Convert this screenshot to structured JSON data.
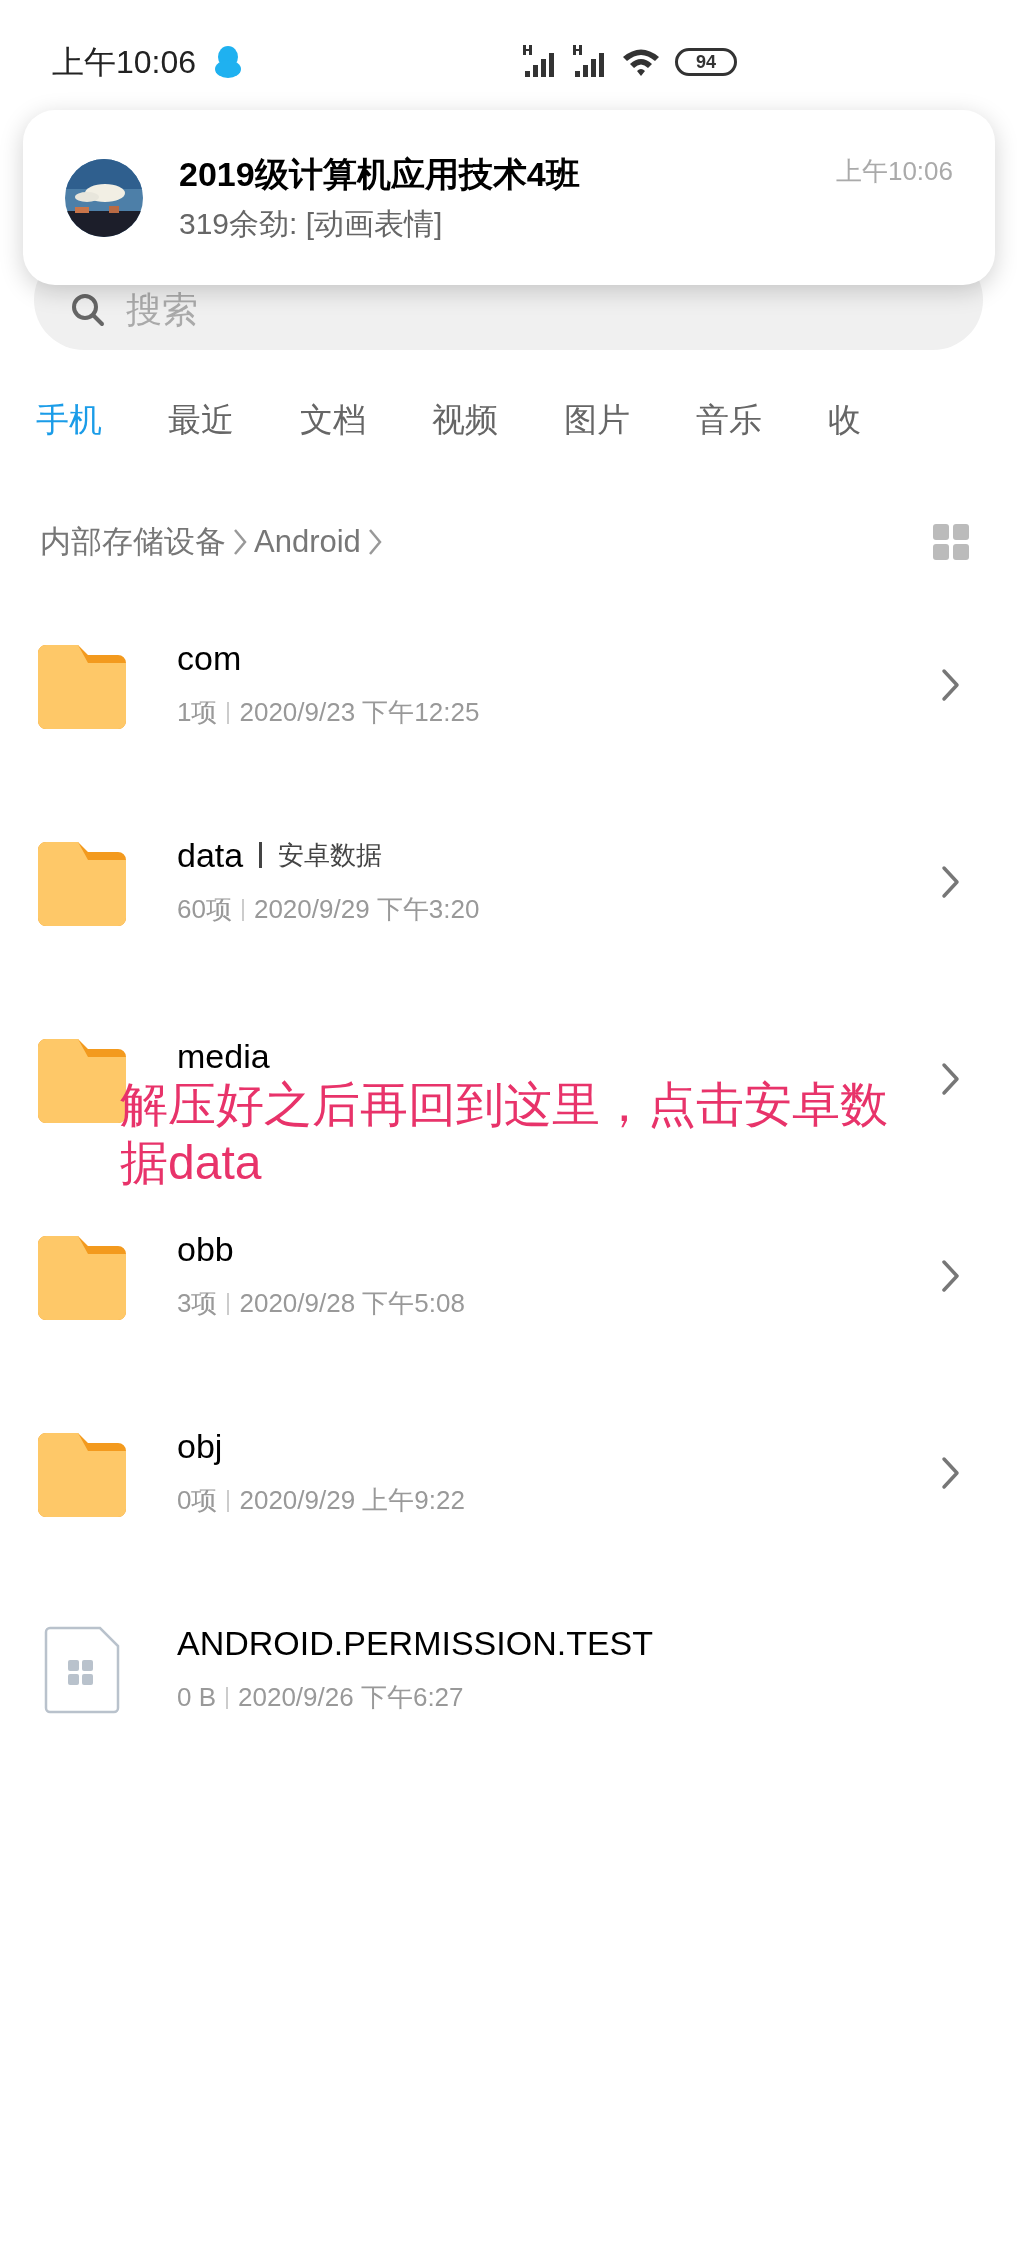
{
  "status_bar": {
    "time": "上午10:06",
    "battery": "94"
  },
  "notification": {
    "title": "2019级计算机应用技术4班",
    "message": "319余劲: [动画表情]",
    "time": "上午10:06"
  },
  "search": {
    "placeholder": "搜索"
  },
  "tabs": [
    {
      "label": "手机",
      "selected": true
    },
    {
      "label": "最近",
      "selected": false
    },
    {
      "label": "文档",
      "selected": false
    },
    {
      "label": "视频",
      "selected": false
    },
    {
      "label": "图片",
      "selected": false
    },
    {
      "label": "音乐",
      "selected": false
    },
    {
      "label": "收",
      "selected": false
    }
  ],
  "breadcrumb": [
    "内部存储设备",
    "Android"
  ],
  "files": [
    {
      "kind": "folder",
      "name": "com",
      "meta": "1项",
      "date": "2020/9/23 下午12:25"
    },
    {
      "kind": "folder",
      "name": "data",
      "tag": "安卓数据",
      "meta": "60项",
      "date": "2020/9/29 下午3:20"
    },
    {
      "kind": "folder",
      "name": "media"
    },
    {
      "kind": "folder",
      "name": "obb",
      "meta": "3项",
      "date": "2020/9/28 下午5:08"
    },
    {
      "kind": "folder",
      "name": "obj",
      "meta": "0项",
      "date": "2020/9/29 上午9:22"
    },
    {
      "kind": "file",
      "name": "ANDROID.PERMISSION.TEST",
      "meta": "0 B",
      "date": "2020/9/26 下午6:27"
    }
  ],
  "annotation": "解压好之后再回到这里，点击安卓数据data"
}
